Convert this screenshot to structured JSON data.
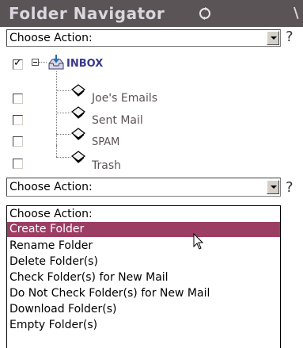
{
  "header": {
    "title": "Folder Navigator",
    "edge_glyph": "\\"
  },
  "top_select": {
    "value": "Choose Action:",
    "help": "?"
  },
  "folders": [
    {
      "label": "INBOX",
      "checked": true,
      "icon": "inbox-tray-icon"
    },
    {
      "label": "Joe's Emails",
      "checked": false,
      "icon": "folder-icon"
    },
    {
      "label": "Sent Mail",
      "checked": false,
      "icon": "folder-icon"
    },
    {
      "label": "SPAM",
      "checked": false,
      "icon": "folder-icon"
    },
    {
      "label": "Trash",
      "checked": false,
      "icon": "folder-icon"
    }
  ],
  "bottom_select": {
    "value": "Choose Action:",
    "help": "?"
  },
  "dropdown": {
    "selected_index": 1,
    "options": [
      "Choose Action:",
      "Create Folder",
      "Rename Folder",
      "Delete Folder(s)",
      "Check Folder(s) for New Mail",
      "Do Not Check Folder(s) for New Mail",
      "Download Folder(s)",
      "Empty Folder(s)"
    ]
  },
  "colors": {
    "header_bg": "#5b5456",
    "header_text": "#d9d6de",
    "selected_bg": "#9c3e63",
    "label_text": "#5b5456"
  }
}
